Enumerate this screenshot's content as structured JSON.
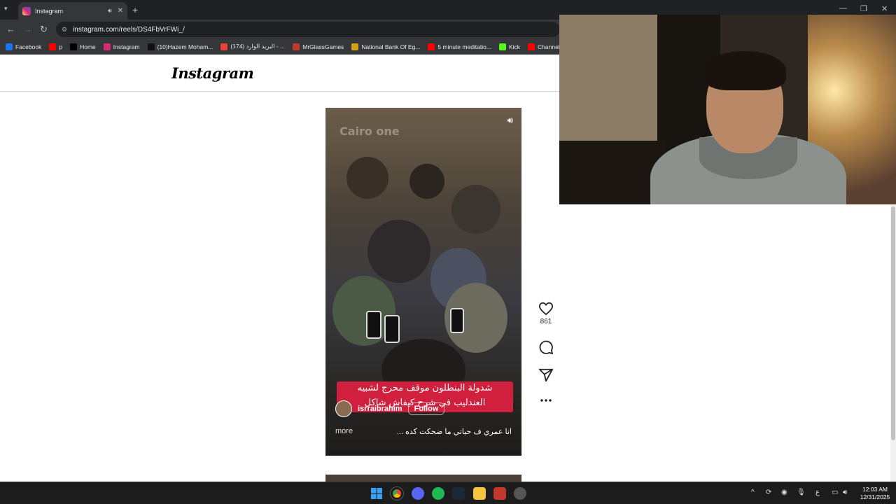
{
  "browser": {
    "tab_title": "Instagram",
    "url": "instagram.com/reels/DS4FbVrFWi_/",
    "bookmarks": [
      {
        "label": "Facebook",
        "color": "#1877f2"
      },
      {
        "label": "p",
        "color": "#ff0000"
      },
      {
        "label": "Home",
        "color": "#000000"
      },
      {
        "label": "Instagram",
        "color": "#d62976"
      },
      {
        "label": "(10)Hazem Moham...",
        "color": "#111111"
      },
      {
        "label": "(174) البريد الوارد - ...",
        "color": "#ea4335"
      },
      {
        "label": "MrGlassGames",
        "color": "#c0392b"
      },
      {
        "label": "National Bank Of Eg...",
        "color": "#d4a017"
      },
      {
        "label": "5 minute meditatio...",
        "color": "#ff0000"
      },
      {
        "label": "Kick",
        "color": "#53fc18"
      },
      {
        "label": "Channel analy...",
        "color": "#ff0000"
      }
    ]
  },
  "instagram": {
    "logo": "Instagram",
    "reel": {
      "watermark": "Cairo one",
      "caption_line1": "شدولة البنطلون موقف محرج لشبيه",
      "caption_line2": "العندليب في شرح كيفاش شاكل",
      "username": "isrraibrahim",
      "follow_label": "Follow",
      "description": "انا عمري ف حياتي ما ضحكت كده ...",
      "more_label": "more"
    },
    "actions": {
      "like_count": "861"
    }
  },
  "taskbar": {
    "lang": "ع",
    "time": "12:03 AM",
    "date": "12/31/2025"
  },
  "colors": {
    "chrome_dark": "#202124",
    "caption_red": "#d11f3e"
  }
}
